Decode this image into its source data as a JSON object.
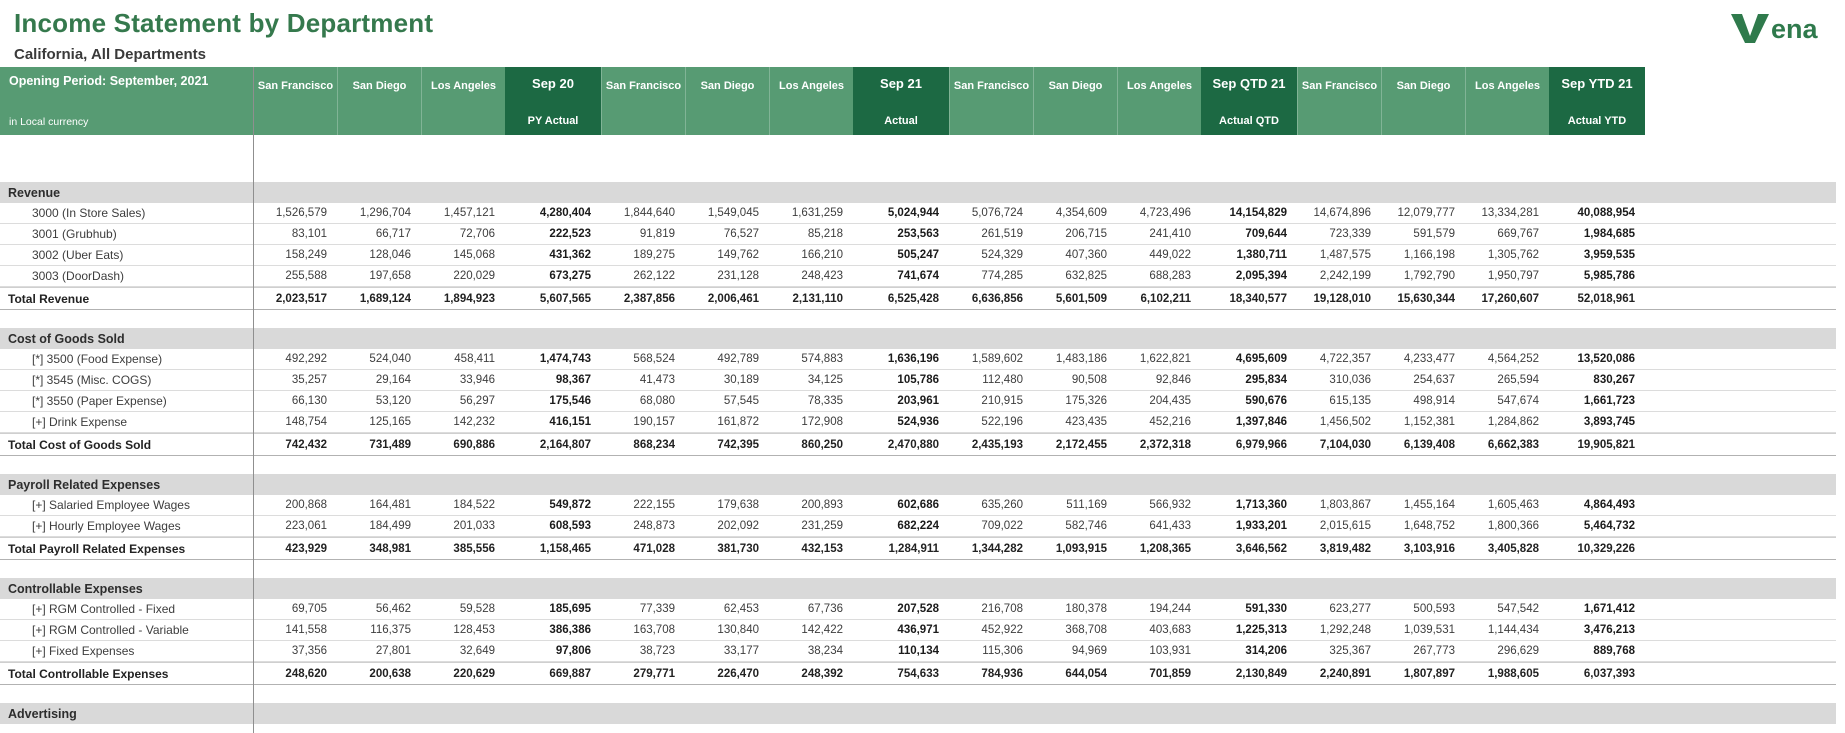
{
  "page": {
    "title": "Income Statement by Department",
    "subtitle": "California, All Departments",
    "logo_text": "ena"
  },
  "colors": {
    "title_green": "#35794d",
    "header_green": "#579b73",
    "header_dark_green": "#1c6943",
    "section_gray": "#d9d9d9",
    "logo_green": "#2f7a4c"
  },
  "sheet": {
    "corner_top": "Opening Period: September, 2021",
    "corner_bottom": "in Local currency",
    "column_groups": [
      {
        "cities": [
          "San Francisco",
          "San Diego",
          "Los Angeles"
        ],
        "period": "Sep 20",
        "scenario": "PY Actual"
      },
      {
        "cities": [
          "San Francisco",
          "San Diego",
          "Los Angeles"
        ],
        "period": "Sep 21",
        "scenario": "Actual"
      },
      {
        "cities": [
          "San Francisco",
          "San Diego",
          "Los Angeles"
        ],
        "period": "Sep QTD 21",
        "scenario": "Actual QTD"
      },
      {
        "cities": [
          "San Francisco",
          "San Diego",
          "Los Angeles"
        ],
        "period": "Sep YTD 21",
        "scenario": "Actual YTD"
      }
    ],
    "sections": [
      {
        "name": "Revenue",
        "rows": [
          {
            "label": "3000 (In Store Sales)",
            "values": [
              "1,526,579",
              "1,296,704",
              "1,457,121",
              "4,280,404",
              "1,844,640",
              "1,549,045",
              "1,631,259",
              "5,024,944",
              "5,076,724",
              "4,354,609",
              "4,723,496",
              "14,154,829",
              "14,674,896",
              "12,079,777",
              "13,334,281",
              "40,088,954"
            ]
          },
          {
            "label": "3001 (Grubhub)",
            "values": [
              "83,101",
              "66,717",
              "72,706",
              "222,523",
              "91,819",
              "76,527",
              "85,218",
              "253,563",
              "261,519",
              "206,715",
              "241,410",
              "709,644",
              "723,339",
              "591,579",
              "669,767",
              "1,984,685"
            ]
          },
          {
            "label": "3002 (Uber Eats)",
            "values": [
              "158,249",
              "128,046",
              "145,068",
              "431,362",
              "189,275",
              "149,762",
              "166,210",
              "505,247",
              "524,329",
              "407,360",
              "449,022",
              "1,380,711",
              "1,487,575",
              "1,166,198",
              "1,305,762",
              "3,959,535"
            ]
          },
          {
            "label": "3003 (DoorDash)",
            "values": [
              "255,588",
              "197,658",
              "220,029",
              "673,275",
              "262,122",
              "231,128",
              "248,423",
              "741,674",
              "774,285",
              "632,825",
              "688,283",
              "2,095,394",
              "2,242,199",
              "1,792,790",
              "1,950,797",
              "5,985,786"
            ]
          }
        ],
        "total": {
          "label": "Total Revenue",
          "values": [
            "2,023,517",
            "1,689,124",
            "1,894,923",
            "5,607,565",
            "2,387,856",
            "2,006,461",
            "2,131,110",
            "6,525,428",
            "6,636,856",
            "5,601,509",
            "6,102,211",
            "18,340,577",
            "19,128,010",
            "15,630,344",
            "17,260,607",
            "52,018,961"
          ]
        }
      },
      {
        "name": "Cost of Goods Sold",
        "rows": [
          {
            "label": "[*] 3500 (Food Expense)",
            "values": [
              "492,292",
              "524,040",
              "458,411",
              "1,474,743",
              "568,524",
              "492,789",
              "574,883",
              "1,636,196",
              "1,589,602",
              "1,483,186",
              "1,622,821",
              "4,695,609",
              "4,722,357",
              "4,233,477",
              "4,564,252",
              "13,520,086"
            ]
          },
          {
            "label": "[*] 3545 (Misc. COGS)",
            "values": [
              "35,257",
              "29,164",
              "33,946",
              "98,367",
              "41,473",
              "30,189",
              "34,125",
              "105,786",
              "112,480",
              "90,508",
              "92,846",
              "295,834",
              "310,036",
              "254,637",
              "265,594",
              "830,267"
            ]
          },
          {
            "label": "[*] 3550 (Paper Expense)",
            "values": [
              "66,130",
              "53,120",
              "56,297",
              "175,546",
              "68,080",
              "57,545",
              "78,335",
              "203,961",
              "210,915",
              "175,326",
              "204,435",
              "590,676",
              "615,135",
              "498,914",
              "547,674",
              "1,661,723"
            ]
          },
          {
            "label": "[+] Drink Expense",
            "values": [
              "148,754",
              "125,165",
              "142,232",
              "416,151",
              "190,157",
              "161,872",
              "172,908",
              "524,936",
              "522,196",
              "423,435",
              "452,216",
              "1,397,846",
              "1,456,502",
              "1,152,381",
              "1,284,862",
              "3,893,745"
            ]
          }
        ],
        "total": {
          "label": "Total Cost of Goods Sold",
          "values": [
            "742,432",
            "731,489",
            "690,886",
            "2,164,807",
            "868,234",
            "742,395",
            "860,250",
            "2,470,880",
            "2,435,193",
            "2,172,455",
            "2,372,318",
            "6,979,966",
            "7,104,030",
            "6,139,408",
            "6,662,383",
            "19,905,821"
          ]
        }
      },
      {
        "name": "Payroll Related Expenses",
        "rows": [
          {
            "label": "[+] Salaried Employee Wages",
            "values": [
              "200,868",
              "164,481",
              "184,522",
              "549,872",
              "222,155",
              "179,638",
              "200,893",
              "602,686",
              "635,260",
              "511,169",
              "566,932",
              "1,713,360",
              "1,803,867",
              "1,455,164",
              "1,605,463",
              "4,864,493"
            ]
          },
          {
            "label": "[+] Hourly Employee Wages",
            "values": [
              "223,061",
              "184,499",
              "201,033",
              "608,593",
              "248,873",
              "202,092",
              "231,259",
              "682,224",
              "709,022",
              "582,746",
              "641,433",
              "1,933,201",
              "2,015,615",
              "1,648,752",
              "1,800,366",
              "5,464,732"
            ]
          }
        ],
        "total": {
          "label": "Total Payroll Related Expenses",
          "values": [
            "423,929",
            "348,981",
            "385,556",
            "1,158,465",
            "471,028",
            "381,730",
            "432,153",
            "1,284,911",
            "1,344,282",
            "1,093,915",
            "1,208,365",
            "3,646,562",
            "3,819,482",
            "3,103,916",
            "3,405,828",
            "10,329,226"
          ]
        }
      },
      {
        "name": "Controllable Expenses",
        "rows": [
          {
            "label": "[+] RGM Controlled - Fixed",
            "values": [
              "69,705",
              "56,462",
              "59,528",
              "185,695",
              "77,339",
              "62,453",
              "67,736",
              "207,528",
              "216,708",
              "180,378",
              "194,244",
              "591,330",
              "623,277",
              "500,593",
              "547,542",
              "1,671,412"
            ]
          },
          {
            "label": "[+] RGM Controlled - Variable",
            "values": [
              "141,558",
              "116,375",
              "128,453",
              "386,386",
              "163,708",
              "130,840",
              "142,422",
              "436,971",
              "452,922",
              "368,708",
              "403,683",
              "1,225,313",
              "1,292,248",
              "1,039,531",
              "1,144,434",
              "3,476,213"
            ]
          },
          {
            "label": "[+] Fixed Expenses",
            "values": [
              "37,356",
              "27,801",
              "32,649",
              "97,806",
              "38,723",
              "33,177",
              "38,234",
              "110,134",
              "115,306",
              "94,969",
              "103,931",
              "314,206",
              "325,367",
              "267,773",
              "296,629",
              "889,768"
            ]
          }
        ],
        "total": {
          "label": "Total Controllable Expenses",
          "values": [
            "248,620",
            "200,638",
            "220,629",
            "669,887",
            "279,771",
            "226,470",
            "248,392",
            "754,633",
            "784,936",
            "644,054",
            "701,859",
            "2,130,849",
            "2,240,891",
            "1,807,897",
            "1,988,605",
            "6,037,393"
          ]
        }
      },
      {
        "name": "Advertising",
        "rows": [],
        "total": null
      }
    ]
  }
}
